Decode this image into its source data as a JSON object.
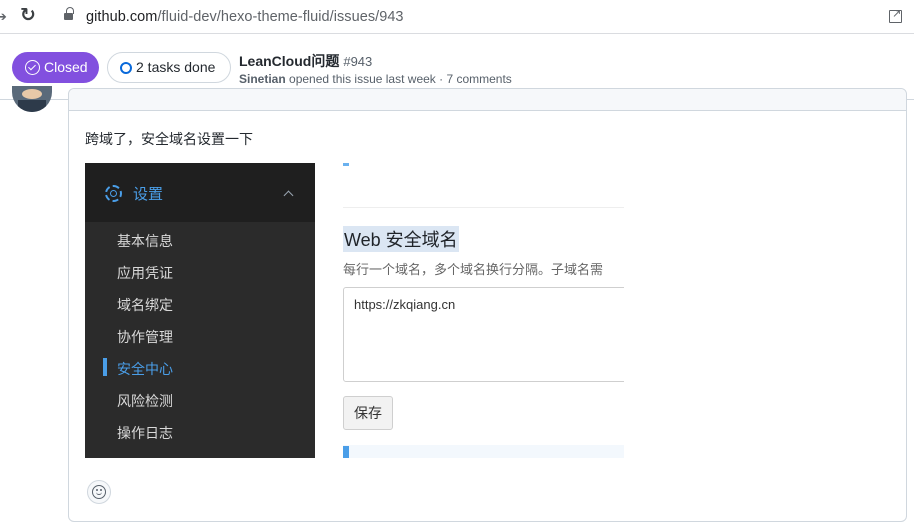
{
  "browser": {
    "url_host": "github.com",
    "url_path": "/fluid-dev/hexo-theme-fluid/issues/943"
  },
  "issue": {
    "state_label": "Closed",
    "tasks_label": "2 tasks done",
    "title": "LeanCloud问题",
    "number": "#943",
    "author": "Sinetian",
    "meta_text": "opened this issue last week · 7 comments"
  },
  "comment": {
    "body": "跨域了，安全域名设置一下"
  },
  "embedded_screenshot": {
    "section_label": "设置",
    "menu": [
      {
        "label": "基本信息",
        "active": false
      },
      {
        "label": "应用凭证",
        "active": false
      },
      {
        "label": "域名绑定",
        "active": false
      },
      {
        "label": "协作管理",
        "active": false
      },
      {
        "label": "安全中心",
        "active": true
      },
      {
        "label": "风险检测",
        "active": false
      },
      {
        "label": "操作日志",
        "active": false
      }
    ],
    "heading": "Web 安全域名",
    "description": "每行一个域名，多个域名换行分隔。子域名需",
    "domain_value": "https://zkqiang.cn",
    "save_label": "保存"
  },
  "colors": {
    "closed_purple": "#8250df",
    "task_blue": "#0969da",
    "leancloud_blue": "#4a9ee8",
    "sidebar_dark": "#2b2b2b"
  }
}
